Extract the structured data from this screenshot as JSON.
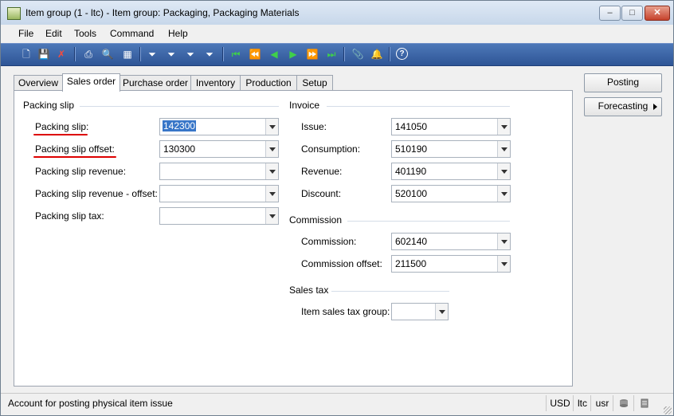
{
  "window": {
    "title": "Item group (1 - ltc) - Item group: Packaging, Packaging Materials",
    "controls": {
      "minimize": "–",
      "maximize": "□",
      "close": "✕"
    }
  },
  "menu": [
    "File",
    "Edit",
    "Tools",
    "Command",
    "Help"
  ],
  "toolbar": {
    "buttons": [
      {
        "name": "new-icon",
        "glyph": "🗋"
      },
      {
        "name": "save-icon",
        "glyph": "💾"
      },
      {
        "name": "delete-icon",
        "glyph": "✗"
      },
      {
        "name": "print-icon",
        "glyph": "⎙"
      },
      {
        "name": "print-preview-icon",
        "glyph": "🔍"
      },
      {
        "name": "export-excel-icon",
        "glyph": "▦"
      },
      {
        "name": "filter-by-selection-icon",
        "glyph": "⏷"
      },
      {
        "name": "filter-by-form-icon",
        "glyph": "⏷"
      },
      {
        "name": "advanced-filter-icon",
        "glyph": "⏷"
      },
      {
        "name": "remove-filter-icon",
        "glyph": "⏷"
      },
      {
        "name": "first-record-icon",
        "glyph": "⏮"
      },
      {
        "name": "previous-page-icon",
        "glyph": "⏪"
      },
      {
        "name": "previous-record-icon",
        "glyph": "◀"
      },
      {
        "name": "next-record-icon",
        "glyph": "▶"
      },
      {
        "name": "next-page-icon",
        "glyph": "⏩"
      },
      {
        "name": "last-record-icon",
        "glyph": "⏭"
      },
      {
        "name": "document-handling-icon",
        "glyph": "📎"
      },
      {
        "name": "alert-icon",
        "glyph": "🔔"
      },
      {
        "name": "help-icon",
        "glyph": "?"
      }
    ]
  },
  "tabs": [
    {
      "label": "Overview",
      "active": false
    },
    {
      "label": "Sales order",
      "active": true
    },
    {
      "label": "Purchase order",
      "active": false
    },
    {
      "label": "Inventory",
      "active": false
    },
    {
      "label": "Production",
      "active": false
    },
    {
      "label": "Setup",
      "active": false
    }
  ],
  "packing_slip_group": {
    "title": "Packing slip",
    "fields": [
      {
        "label": "Packing slip:",
        "value": "142300",
        "underlined": true,
        "selected": true
      },
      {
        "label": "Packing slip offset:",
        "value": "130300",
        "underlined": true,
        "selected": false
      },
      {
        "label": "Packing slip revenue:",
        "value": "",
        "underlined": false,
        "selected": false
      },
      {
        "label": "Packing slip revenue - offset:",
        "value": "",
        "underlined": false,
        "selected": false
      },
      {
        "label": "Packing slip tax:",
        "value": "",
        "underlined": false,
        "selected": false
      }
    ]
  },
  "invoice_group": {
    "title": "Invoice",
    "fields": [
      {
        "label": "Issue:",
        "value": "141050"
      },
      {
        "label": "Consumption:",
        "value": "510190"
      },
      {
        "label": "Revenue:",
        "value": "401190"
      },
      {
        "label": "Discount:",
        "value": "520100"
      }
    ]
  },
  "commission_group": {
    "title": "Commission",
    "fields": [
      {
        "label": "Commission:",
        "value": "602140"
      },
      {
        "label": "Commission offset:",
        "value": "211500"
      }
    ]
  },
  "sales_tax_group": {
    "title": "Sales tax",
    "fields": [
      {
        "label": "Item sales tax group:",
        "value": ""
      }
    ]
  },
  "side_buttons": {
    "posting": "Posting",
    "forecasting": "Forecasting"
  },
  "status": {
    "message": "Account for posting physical item issue",
    "currency": "USD",
    "company": "ltc",
    "layer": "usr"
  },
  "colors": {
    "underline": "#d00000",
    "selection": "#3876c8",
    "toolbar": "#3a64a8"
  }
}
